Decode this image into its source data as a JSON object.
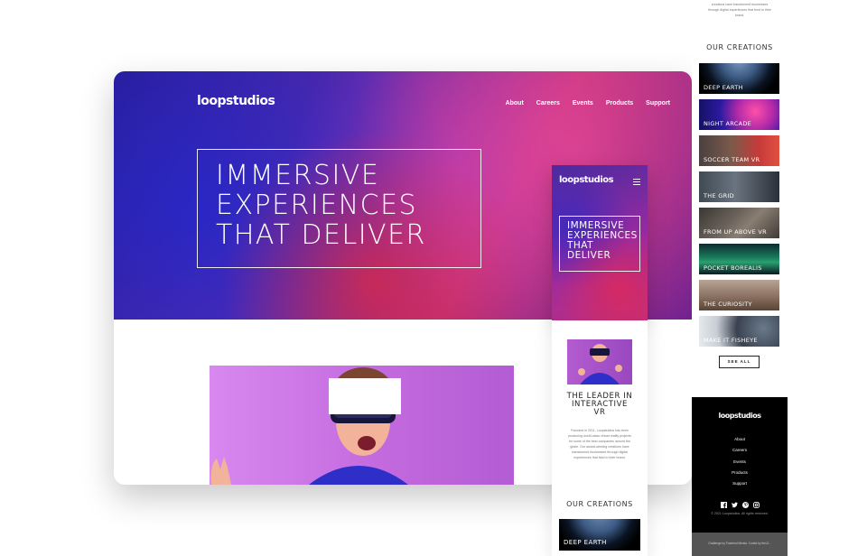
{
  "desktop": {
    "logo": "loopstudios",
    "nav": [
      "About",
      "Careers",
      "Events",
      "Products",
      "Support"
    ],
    "headline": [
      "IMMERSIVE",
      "EXPERIENCES",
      "THAT DELIVER"
    ]
  },
  "mobile": {
    "logo": "loopstudios",
    "headline": [
      "IMMERSIVE",
      "EXPERIENCES",
      "THAT",
      "DELIVER"
    ],
    "leader_heading": [
      "THE LEADER IN",
      "INTERACTIVE",
      "VR"
    ],
    "leader_text": "Founded in 2011, Loopstudios has been producing world-class virtual reality projects for some of the best companies around the globe. Our award-winning creations have transformed businesses through digital experiences that bind to their brand.",
    "creations_heading": "OUR CREATIONS",
    "first_creation": "DEEP EARTH"
  },
  "tablet": {
    "about_tail": "creations have transformed businesses through digital experiences that bind to their brand.",
    "creations_heading": "OUR CREATIONS",
    "creations": [
      {
        "label": "DEEP EARTH"
      },
      {
        "label": "NIGHT ARCADE"
      },
      {
        "label": "SOCCER TEAM VR"
      },
      {
        "label": "THE GRID"
      },
      {
        "label": "FROM UP ABOVE VR"
      },
      {
        "label": "POCKET BOREALIS"
      },
      {
        "label": "THE CURIOSITY"
      },
      {
        "label": "MAKE IT FISHEYE"
      }
    ],
    "see_all": "SEE ALL"
  },
  "footer": {
    "logo": "loopstudios",
    "nav": [
      "About",
      "Careers",
      "Events",
      "Products",
      "Support"
    ],
    "social_icons": [
      "facebook-icon",
      "twitter-icon",
      "pinterest-icon",
      "instagram-icon"
    ],
    "copyright": "© 2021 Loopstudios. All rights reserved.",
    "attribution": "Challenge by Frontend Mentor. Coded by theJJ..."
  }
}
